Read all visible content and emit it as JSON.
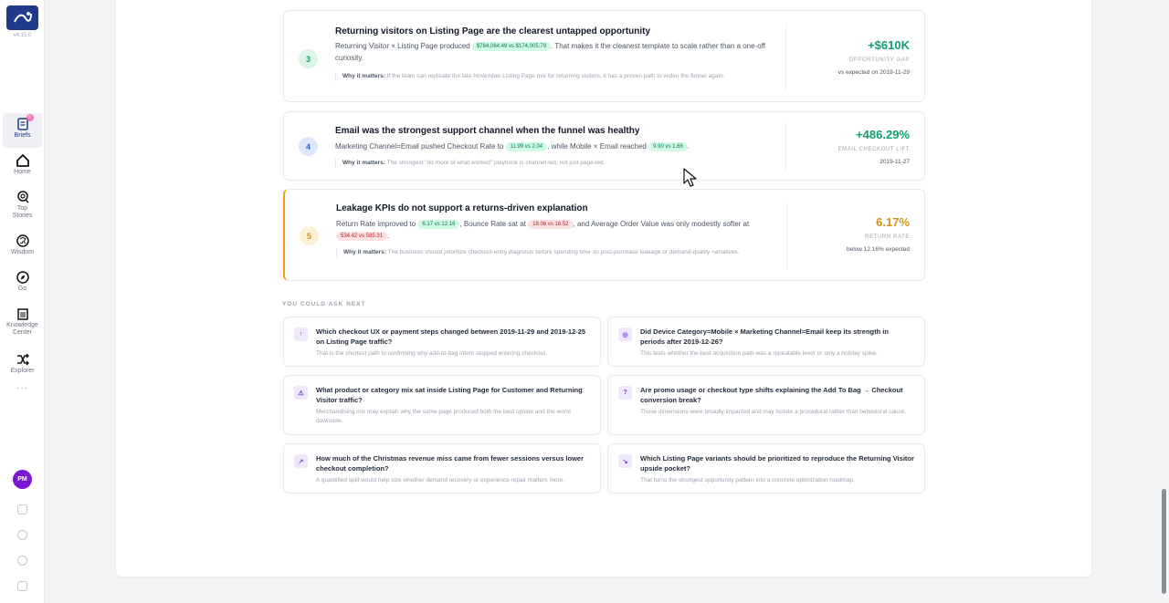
{
  "app": {
    "version": "v4.15.0",
    "brand_color": "#1f3a8a"
  },
  "sidebar": {
    "items": [
      {
        "label": "Briefs",
        "icon": "briefs-icon",
        "badge": "9"
      },
      {
        "label": "Home",
        "icon": "home-icon"
      },
      {
        "label": "Top Stories",
        "icon": "top-stories-icon"
      },
      {
        "label": "Wisdom",
        "icon": "wisdom-icon"
      },
      {
        "label": "Go",
        "icon": "compass-icon"
      },
      {
        "label": "Knowledge Center",
        "icon": "building-icon"
      },
      {
        "label": "Explorer",
        "icon": "shuffle-icon"
      }
    ],
    "more": "···",
    "avatar_initials": "PM"
  },
  "insights": [
    {
      "number": "3",
      "title": "Returning visitors on Listing Page are the clearest untapped opportunity",
      "body_pre": "Returning Visitor × Listing Page produced",
      "pill1": "$784,064.49 vs $174,005.79",
      "body_mid": ". That makes it the cleanest template to scale rather than a one-off curiosity.",
      "why_label": "Why it matters:",
      "why_text": "If the team can replicate the late-November Listing Page mix for returning visitors, it has a proven path to widen the funnel again.",
      "metric_value": "+$610K",
      "metric_label": "OPPORTUNITY GAP",
      "metric_sub": "vs expected on 2019-11-29"
    },
    {
      "number": "4",
      "title": "Email was the strongest support channel when the funnel was healthy",
      "body_pre": "Marketing Channel=Email pushed Checkout Rate to",
      "pill1": "11.99 vs 2.04",
      "body_mid": ", while Mobile × Email reached",
      "pill2": "9.90 vs 1.66",
      "body_end": ".",
      "why_label": "Why it matters:",
      "why_text": "The strongest \"do more of what worked\" playbook is channel-led, not just page-led.",
      "metric_value": "+486.29%",
      "metric_label": "EMAIL CHECKOUT LIFT",
      "metric_sub": "2019-11-27"
    },
    {
      "number": "5",
      "title": "Leakage KPIs do not support a returns-driven explanation",
      "body_pre": "Return Rate improved to",
      "pill1": "6.17 vs 12.16",
      "body_mid": ", Bounce Rate sat at",
      "pill2": "18.06 vs 18.52",
      "body_mid2": ", and Average Order Value was only modestly softer at",
      "pill3": "534.42 vs 585.31",
      "body_end": ".",
      "why_label": "Why it matters:",
      "why_text": "The business should prioritize checkout-entry diagnosis before spending time on post-purchase leakage or demand-quality narratives.",
      "metric_value": "6.17%",
      "metric_label": "RETURN RATE",
      "metric_sub": "below 12.16% expected"
    }
  ],
  "ask_next": {
    "heading": "YOU COULD ASK NEXT",
    "questions": [
      {
        "icon": "↑",
        "title": "Which checkout UX or payment steps changed between 2019-11-29 and 2019-12-25 on Listing Page traffic?",
        "sub": "That is the shortest path to confirming why add-to-bag intent stopped entering checkout."
      },
      {
        "icon": "◎",
        "title": "Did Device Category=Mobile × Marketing Channel=Email keep its strength in periods after 2019-12-26?",
        "sub": "This tests whether the best acquisition path was a repeatable lever or only a holiday spike."
      },
      {
        "icon": "⚠",
        "title": "What product or category mix sat inside Listing Page for Customer and Returning Visitor traffic?",
        "sub": "Merchandising mix may explain why the same page produced both the best upside and the worst downside."
      },
      {
        "icon": "?",
        "title": "Are promo usage or checkout type shifts explaining the Add To Bag → Checkout conversion break?",
        "sub": "Those dimensions were broadly impacted and may isolate a procedural rather than behavioral cause."
      },
      {
        "icon": "↗",
        "title": "How much of the Christmas revenue miss came from fewer sessions versus lower checkout completion?",
        "sub": "A quantified split would help size whether demand recovery or experience repair matters more."
      },
      {
        "icon": "↘",
        "title": "Which Listing Page variants should be prioritized to reproduce the Returning Visitor upside pocket?",
        "sub": "That turns the strongest opportunity pattern into a concrete optimization roadmap."
      }
    ]
  },
  "colors": {
    "positive": "#0f9f6e",
    "warning": "#d4911a",
    "accent_purple": "#7c3aed"
  }
}
